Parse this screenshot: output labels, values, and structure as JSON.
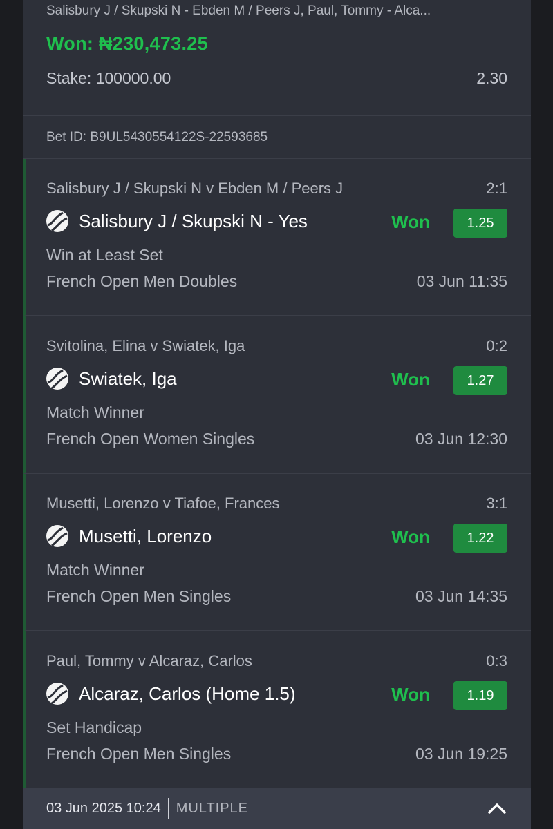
{
  "summary": {
    "description": "Salisbury J / Skupski N - Ebden M / Peers J, Paul, Tommy - Alca...",
    "won": "Won: ₦230,473.25",
    "stake": "Stake: 100000.00",
    "total_odds": "2.30"
  },
  "bet_id": "Bet ID: B9UL5430554122S-22593685",
  "selections": [
    {
      "match": "Salisbury J / Skupski N v Ebden M / Peers J",
      "score": "2:1",
      "pick": "Salisbury J / Skupski N - Yes",
      "status": "Won",
      "odd": "1.25",
      "market": "Win at Least Set",
      "competition": "French Open Men Doubles",
      "time": "03 Jun 11:35"
    },
    {
      "match": "Svitolina, Elina v Swiatek, Iga",
      "score": "0:2",
      "pick": "Swiatek, Iga",
      "status": "Won",
      "odd": "1.27",
      "market": "Match Winner",
      "competition": "French Open Women Singles",
      "time": "03 Jun 12:30"
    },
    {
      "match": "Musetti, Lorenzo v Tiafoe, Frances",
      "score": "3:1",
      "pick": "Musetti, Lorenzo",
      "status": "Won",
      "odd": "1.22",
      "market": "Match Winner",
      "competition": "French Open Men Singles",
      "time": "03 Jun 14:35"
    },
    {
      "match": "Paul, Tommy v Alcaraz, Carlos",
      "score": "0:3",
      "pick": "Alcaraz, Carlos (Home 1.5)",
      "status": "Won",
      "odd": "1.19",
      "market": "Set Handicap",
      "competition": "French Open Men Singles",
      "time": "03 Jun 19:25"
    }
  ],
  "footer": {
    "datetime": "03 Jun 2025 10:24",
    "bet_type": "MULTIPLE",
    "collapse_icon": "chevron-up-icon"
  },
  "colors": {
    "won_green": "#1fbf4e",
    "odd_badge": "#1f8b3f",
    "card_bg": "#2d3039"
  }
}
